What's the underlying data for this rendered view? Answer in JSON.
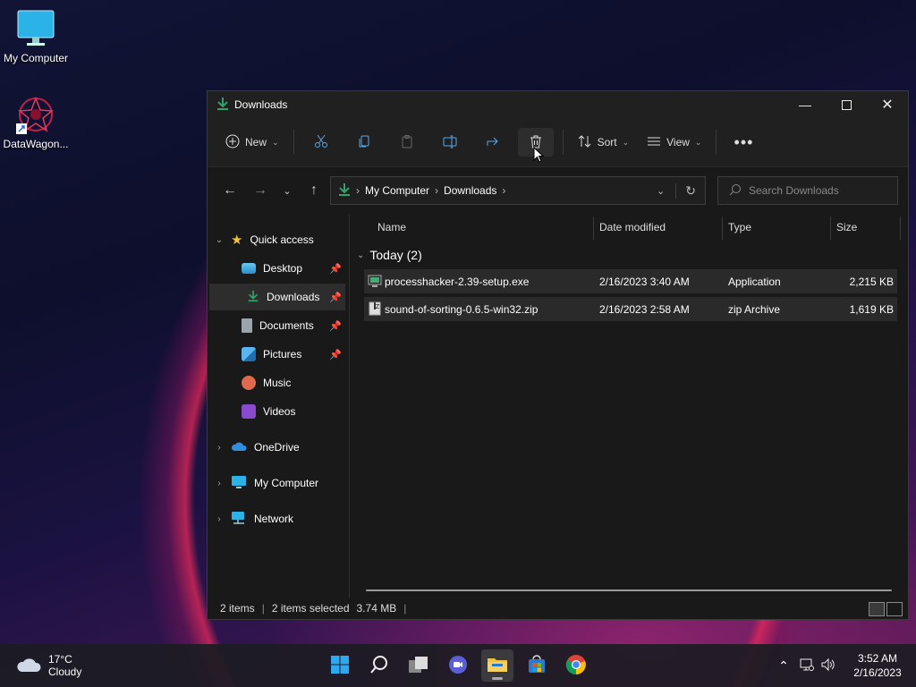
{
  "desktop": {
    "icons": [
      {
        "label": "My Computer"
      },
      {
        "label": "DataWagon..."
      }
    ]
  },
  "window": {
    "title": "Downloads",
    "toolbar": {
      "new_label": "New",
      "sort_label": "Sort",
      "view_label": "View"
    },
    "address": {
      "crumbs": [
        "My Computer",
        "Downloads"
      ]
    },
    "search": {
      "placeholder": "Search Downloads"
    },
    "sidebar": {
      "quick_access": "Quick access",
      "items": [
        {
          "label": "Desktop",
          "pinned": true
        },
        {
          "label": "Downloads",
          "pinned": true,
          "selected": true
        },
        {
          "label": "Documents",
          "pinned": true
        },
        {
          "label": "Pictures",
          "pinned": true
        },
        {
          "label": "Music"
        },
        {
          "label": "Videos"
        }
      ],
      "roots": [
        {
          "label": "OneDrive"
        },
        {
          "label": "My Computer"
        },
        {
          "label": "Network"
        }
      ]
    },
    "columns": {
      "name": "Name",
      "date": "Date modified",
      "type": "Type",
      "size": "Size"
    },
    "group": {
      "label": "Today (2)"
    },
    "files": [
      {
        "name": "processhacker-2.39-setup.exe",
        "date": "2/16/2023 3:40 AM",
        "type": "Application",
        "size": "2,215 KB"
      },
      {
        "name": "sound-of-sorting-0.6.5-win32.zip",
        "date": "2/16/2023 2:58 AM",
        "type": "zip Archive",
        "size": "1,619 KB"
      }
    ],
    "status": {
      "count": "2 items",
      "selected": "2 items selected",
      "size": "3.74 MB"
    }
  },
  "taskbar": {
    "weather": {
      "temp": "17°C",
      "condition": "Cloudy"
    },
    "clock": {
      "time": "3:52 AM",
      "date": "2/16/2023"
    }
  },
  "colors": {
    "accent": "#2fa36b",
    "folder": "#f0c040",
    "selection": "#2d2d2d"
  }
}
